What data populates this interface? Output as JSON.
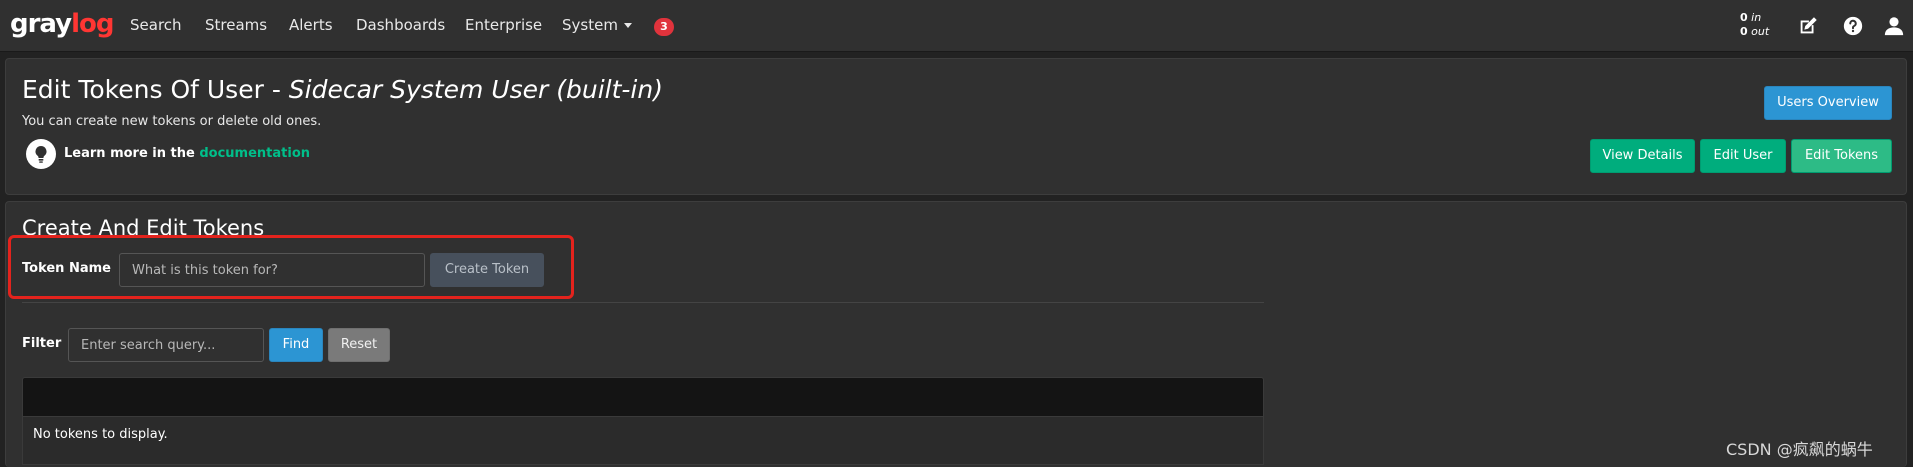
{
  "nav": {
    "logo_gray": "gray",
    "logo_log": "log",
    "items": [
      "Search",
      "Streams",
      "Alerts",
      "Dashboards",
      "Enterprise",
      "System"
    ],
    "notification_count": "3",
    "throughput_in": "0",
    "throughput_in_label": "in",
    "throughput_out": "0",
    "throughput_out_label": "out",
    "icons": [
      "edit-icon",
      "help-icon",
      "user-icon"
    ]
  },
  "header": {
    "title_prefix": "Edit Tokens Of User - ",
    "title_user": "Sidecar System User (built-in)",
    "subtitle": "You can create new tokens or delete old ones.",
    "learn_text": "Learn more in the ",
    "learn_link": "documentation",
    "buttons": {
      "users_overview": "Users Overview",
      "view_details": "View Details",
      "edit_user": "Edit User",
      "edit_tokens": "Edit Tokens"
    }
  },
  "tokens": {
    "section_title": "Create And Edit Tokens",
    "token_name_label": "Token Name",
    "token_name_placeholder": "What is this token for?",
    "create_button": "Create Token",
    "filter_label": "Filter",
    "filter_placeholder": "Enter search query...",
    "find_button": "Find",
    "reset_button": "Reset",
    "empty_message": "No tokens to display."
  },
  "watermark": "CSDN @疯飙的蜗牛",
  "colors": {
    "accent_blue": "#2c95d3",
    "accent_green": "#00ad7d",
    "highlight_red": "#e3231d",
    "badge_red": "#e0333c"
  }
}
